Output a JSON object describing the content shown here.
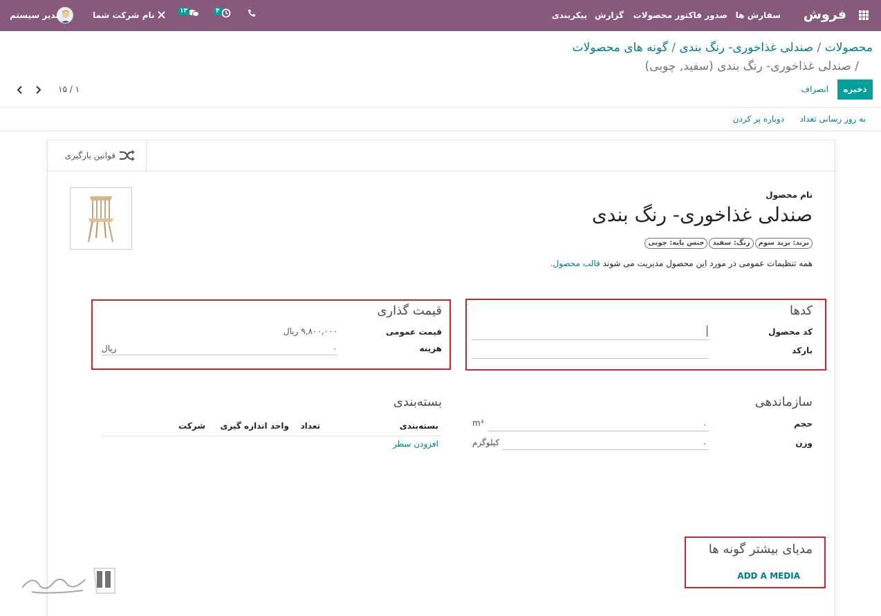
{
  "navbar": {
    "app_name": "فروش",
    "menu": [
      "سفارش ها",
      "صدور فاکتور",
      "محصولات",
      "گزارش",
      "پیکربندی"
    ],
    "activity_count": "۴",
    "messages_count": "۱۳",
    "company": "نام شرکت شما",
    "user": "مدیر سیستم"
  },
  "breadcrumb": {
    "item1": "محصولات",
    "item2": "صندلی غذاخوری- رنگ بندی",
    "item3": "گونه های محصولات",
    "current": "/ صندلی غذاخوری- رنگ بندی (سفید, چوبی)"
  },
  "control": {
    "save": "ذخیره",
    "discard": "انصراف",
    "pager": "۱ / ۱۵"
  },
  "actions": {
    "update_qty": "به روز رسانی تعداد",
    "replenish": "دوباره پر کردن"
  },
  "smart_button": {
    "label": "قوانین بارگیری"
  },
  "product": {
    "name_label": "نام محصول",
    "name": "صندلی غذاخوری- رنگ بندی",
    "tags": [
      "برند: برند سوم",
      "رنگ: سفید",
      "جنس پایه: چوبی"
    ],
    "info_text": "همه تنظیمات عمومی در مورد این محصول مدیریت می شوند",
    "info_link": "قالب محصول."
  },
  "codes": {
    "title": "کدها",
    "internal_ref_label": "کد محصول",
    "internal_ref_value": "",
    "barcode_label": "بارکد",
    "barcode_value": ""
  },
  "pricing": {
    "title": "قیمت گذاری",
    "sales_price_label": "قیمت عمومی",
    "sales_price_value": "۹,۸۰۰,۰۰۰ ریال",
    "cost_label": "هزینه",
    "cost_value": "۰",
    "cost_currency": "ریال"
  },
  "logistics": {
    "title": "سازماندهی",
    "volume_label": "حجم",
    "volume_value": "۰",
    "volume_unit": "m³",
    "weight_label": "وزن",
    "weight_value": "۰",
    "weight_unit": "کیلوگرم"
  },
  "packaging": {
    "title": "بسته‌بندی",
    "columns": [
      "بسته‌بندی",
      "تعداد",
      "واحد اندازه گیری",
      "شرکت"
    ],
    "add_line": "افزودن سطر"
  },
  "media": {
    "title": "مدیای بیشتر گونه ها",
    "add_button": "ADD A MEDIA"
  },
  "colors": {
    "navbar": "#875a7b",
    "accent": "#00a09d",
    "link": "#017e84",
    "highlight_box": "#d3232a"
  }
}
